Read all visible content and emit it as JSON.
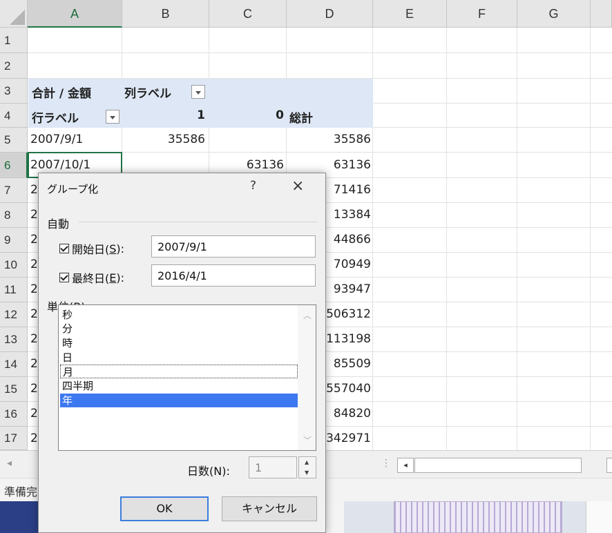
{
  "columns": [
    "A",
    "B",
    "C",
    "D",
    "E",
    "F",
    "G"
  ],
  "rows": [
    "1",
    "2",
    "3",
    "4",
    "5",
    "6",
    "7",
    "8",
    "9",
    "10",
    "11",
    "12",
    "13",
    "14",
    "15",
    "16",
    "17"
  ],
  "cells": {
    "r3_a": "合計 / 金額",
    "r3_b": "列ラベル",
    "r4_a": "行ラベル",
    "r4_b": "1",
    "r4_c": "0",
    "r4_d": "総計",
    "r5_a": "2007/9/1",
    "r5_b": "35586",
    "r5_d": "35586",
    "r6_a": "2007/10/1",
    "r6_c": "63136",
    "r6_d": "63136",
    "a_partial": "2",
    "d_partial": [
      "71416",
      "13384",
      "44866",
      "70949",
      "93947",
      "506312",
      "113198",
      "85509",
      "557040",
      "84820",
      "342971"
    ]
  },
  "dialog": {
    "title": "グループ化",
    "help": "?",
    "close": "×",
    "auto_label": "自動",
    "start_label": "開始日(",
    "start_key": "S",
    "start_suffix": "):",
    "start_value": "2007/9/1",
    "end_label": "最終日(",
    "end_key": "E",
    "end_suffix": "):",
    "end_value": "2016/4/1",
    "unit_label": "単位(",
    "unit_key": "B",
    "unit_suffix": ")",
    "units": [
      "秒",
      "分",
      "時",
      "日",
      "月",
      "四半期",
      "年"
    ],
    "focused_unit": "月",
    "selected_unit": "年",
    "days_label": "日数(N):",
    "days_value": "1",
    "ok": "OK",
    "cancel": "キャンセル"
  },
  "status": "準備完"
}
